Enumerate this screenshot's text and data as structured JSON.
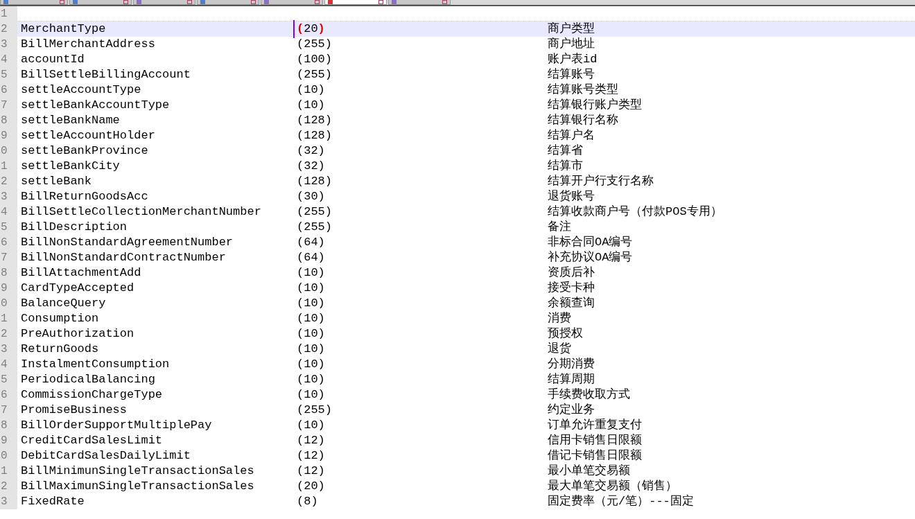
{
  "tabs": [
    {
      "selected": false,
      "color": "#4a7fd4"
    },
    {
      "selected": false,
      "color": "#4a7fd4"
    },
    {
      "selected": false,
      "color": "#8a6fc8"
    },
    {
      "selected": false,
      "color": "#4a7fd4"
    },
    {
      "selected": false,
      "color": "#8a6fc8"
    },
    {
      "selected": true,
      "color": "#e03030"
    },
    {
      "selected": false,
      "color": "#8a6fc8"
    }
  ],
  "lines": [
    {
      "number": "1",
      "current": false
    },
    {
      "number": "2",
      "name": "MerchantType",
      "size": "(20)",
      "comment": "商户类型",
      "current": true,
      "brace_match": true
    },
    {
      "number": "3",
      "name": "BillMerchantAddress",
      "size": "(255)",
      "comment": "商户地址",
      "current": false
    },
    {
      "number": "4",
      "name": "accountId",
      "size": "(100)",
      "comment": "账户表id",
      "current": false
    },
    {
      "number": "5",
      "name": "BillSettleBillingAccount",
      "size": "(255)",
      "comment": "结算账号",
      "current": false
    },
    {
      "number": "6",
      "name": "settleAccountType",
      "size": "(10)",
      "comment": "结算账号类型",
      "current": false
    },
    {
      "number": "7",
      "name": "settleBankAccountType",
      "size": "(10)",
      "comment": "结算银行账户类型",
      "current": false
    },
    {
      "number": "8",
      "name": "settleBankName",
      "size": "(128)",
      "comment": "结算银行名称",
      "current": false
    },
    {
      "number": "9",
      "name": "settleAccountHolder",
      "size": "(128)",
      "comment": "结算户名",
      "current": false
    },
    {
      "number": "0",
      "name": "settleBankProvince",
      "size": "(32)",
      "comment": "结算省",
      "current": false
    },
    {
      "number": "1",
      "name": "settleBankCity",
      "size": "(32)",
      "comment": "结算市",
      "current": false
    },
    {
      "number": "2",
      "name": "settleBank",
      "size": "(128)",
      "comment": "结算开户行支行名称",
      "current": false
    },
    {
      "number": "3",
      "name": "BillReturnGoodsAcc",
      "size": "(30)",
      "comment": "退货账号",
      "current": false
    },
    {
      "number": "4",
      "name": "BillSettleCollectionMerchantNumber",
      "size": "(255)",
      "comment": "结算收款商户号（付款POS专用）",
      "current": false
    },
    {
      "number": "5",
      "name": "BillDescription",
      "size": "(255)",
      "comment": "备注",
      "current": false
    },
    {
      "number": "6",
      "name": "BillNonStandardAgreementNumber",
      "size": "(64)",
      "comment": "非标合同OA编号",
      "current": false
    },
    {
      "number": "7",
      "name": "BillNonStandardContractNumber",
      "size": "(64)",
      "comment": "补充协议OA编号",
      "current": false
    },
    {
      "number": "8",
      "name": "BillAttachmentAdd",
      "size": "(10)",
      "comment": "资质后补",
      "current": false
    },
    {
      "number": "9",
      "name": "CardTypeAccepted",
      "size": "(10)",
      "comment": "接受卡种",
      "current": false
    },
    {
      "number": "0",
      "name": "BalanceQuery",
      "size": "(10)",
      "comment": "余额查询",
      "current": false
    },
    {
      "number": "1",
      "name": "Consumption",
      "size": "(10)",
      "comment": "消费",
      "current": false
    },
    {
      "number": "2",
      "name": "PreAuthorization",
      "size": "(10)",
      "comment": "预授权",
      "current": false
    },
    {
      "number": "3",
      "name": "ReturnGoods",
      "size": "(10)",
      "comment": "退货",
      "current": false
    },
    {
      "number": "4",
      "name": "InstalmentConsumption",
      "size": "(10)",
      "comment": "分期消费",
      "current": false
    },
    {
      "number": "5",
      "name": "PeriodicalBalancing",
      "size": "(10)",
      "comment": "结算周期",
      "current": false
    },
    {
      "number": "6",
      "name": "CommissionChargeType",
      "size": "(10)",
      "comment": "手续费收取方式",
      "current": false
    },
    {
      "number": "7",
      "name": "PromiseBusiness",
      "size": "(255)",
      "comment": "约定业务",
      "current": false
    },
    {
      "number": "8",
      "name": "BillOrderSupportMultiplePay",
      "size": "(10)",
      "comment": "订单允许重复支付",
      "current": false
    },
    {
      "number": "9",
      "name": "CreditCardSalesLimit",
      "size": "(12)",
      "comment": "信用卡销售日限额",
      "current": false
    },
    {
      "number": "0",
      "name": "DebitCardSalesDailyLimit",
      "size": "(12)",
      "comment": "借记卡销售日限额",
      "current": false
    },
    {
      "number": "1",
      "name": "BillMinimunSingleTransactionSales",
      "size": "(12)",
      "comment": "最小单笔交易额",
      "current": false
    },
    {
      "number": "2",
      "name": "BillMaximunSingleTransactionSales",
      "size": "(20)",
      "comment": "最大单笔交易额（销售）",
      "current": false
    },
    {
      "number": "3",
      "name": "FixedRate",
      "size": "(8)",
      "comment": "固定费率（元/笔）---固定",
      "current": false
    }
  ]
}
